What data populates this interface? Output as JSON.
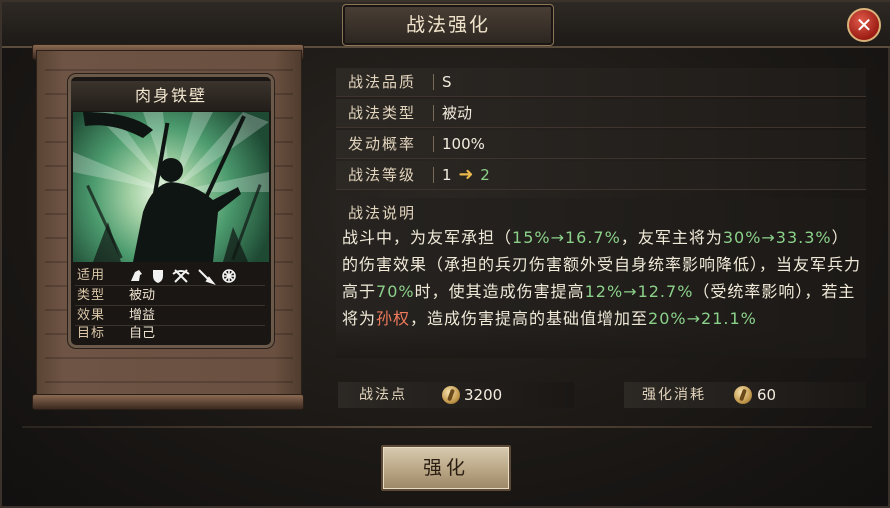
{
  "window": {
    "title": "战法强化",
    "close_label": "✕"
  },
  "card": {
    "name": "肉身铁壁",
    "attributes": [
      {
        "key": "适用",
        "value": ""
      },
      {
        "key": "类型",
        "value": "被动"
      },
      {
        "key": "效果",
        "value": "增益"
      },
      {
        "key": "目标",
        "value": "自己"
      }
    ],
    "applicable_icons": [
      "cavalry-icon",
      "shield-icon",
      "crossbow-icon",
      "spear-icon",
      "wheel-icon"
    ]
  },
  "info": {
    "quality_label": "战法品质",
    "quality_value": "S",
    "type_label": "战法类型",
    "type_value": "被动",
    "rate_label": "发动概率",
    "rate_value": "100%",
    "level_label": "战法等级",
    "level_from": "1",
    "level_arrow": "➜",
    "level_to": "2"
  },
  "description": {
    "title": "战法说明",
    "segments": [
      {
        "t": "战斗中，为友军承担（",
        "c": "n"
      },
      {
        "t": "15%→16.7%",
        "c": "g"
      },
      {
        "t": "，友军主将为",
        "c": "n"
      },
      {
        "t": "30%→33.3%",
        "c": "g"
      },
      {
        "t": "）的伤害效果（承担的兵刃伤害额外受自身统率影响降低），当友军兵力高于",
        "c": "n"
      },
      {
        "t": "70%",
        "c": "g"
      },
      {
        "t": "时，使其造成伤害提高",
        "c": "n"
      },
      {
        "t": "12%→12.7%",
        "c": "g"
      },
      {
        "t": "（受统率影响），若主将为",
        "c": "n"
      },
      {
        "t": "孙权",
        "c": "r"
      },
      {
        "t": "，造成伤害提高的基础值增加至",
        "c": "n"
      },
      {
        "t": "20%→21.1%",
        "c": "g"
      }
    ]
  },
  "stats": {
    "points_label": "战法点",
    "points_value": "3200",
    "cost_label": "强化消耗",
    "cost_value": "60"
  },
  "button": {
    "label": "强化"
  },
  "colors": {
    "highlight_green": "#8bd18a",
    "highlight_red": "#ef7a5c",
    "text": "#f1ead9"
  }
}
